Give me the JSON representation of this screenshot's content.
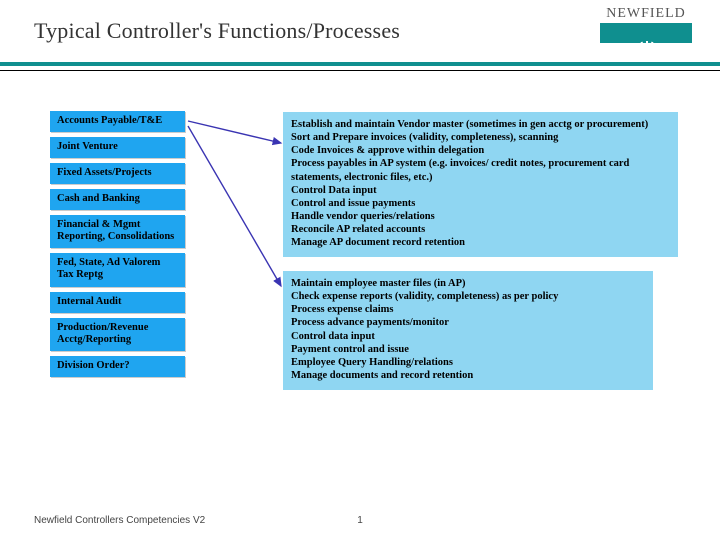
{
  "header": {
    "title": "Typical Controller's Functions/Processes",
    "brand": "NEWFIELD"
  },
  "sidebar": {
    "items": [
      "Accounts Payable/T&E",
      "Joint Venture",
      "Fixed Assets/Projects",
      "Cash and Banking",
      "Financial & Mgmt Reporting, Consolidations",
      "Fed, State, Ad Valorem Tax Reptg",
      "Internal Audit",
      "Production/Revenue Acctg/Reporting",
      "Division Order?"
    ]
  },
  "panels": {
    "top": [
      "Establish and maintain Vendor master (sometimes in gen acctg or procurement)",
      "Sort and Prepare invoices (validity, completeness), scanning",
      "Code Invoices  & approve within delegation",
      "Process payables in AP system (e.g. invoices/ credit notes, procurement card statements, electronic files, etc.)",
      "Control Data input",
      "Control and issue payments",
      "Handle vendor queries/relations",
      "Reconcile AP related accounts",
      "Manage AP document record retention"
    ],
    "bottom": [
      "Maintain employee master files (in AP)",
      "Check expense reports (validity,  completeness) as per policy",
      "Process expense claims",
      "Process advance payments/monitor",
      "Control data input",
      "Payment control and issue",
      "Employee Query Handling/relations",
      "Manage documents and record retention"
    ]
  },
  "footer": {
    "left": "Newfield Controllers Competencies V2",
    "page": "1"
  },
  "colors": {
    "teal": "#0f8f8f",
    "box_blue": "#1fa5f0",
    "panel_blue": "#8fd6f2",
    "arrow": "#3a34b2"
  }
}
